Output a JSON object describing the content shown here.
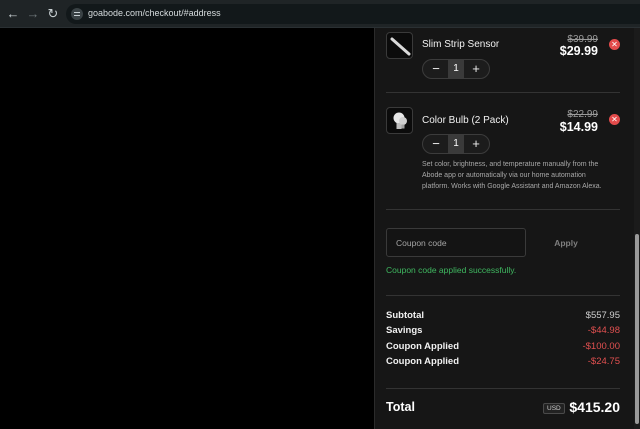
{
  "browser": {
    "url": "goabode.com/checkout/#address",
    "back_icon": "arrow-left-icon",
    "forward_icon": "arrow-right-icon",
    "reload_icon": "reload-icon"
  },
  "cart": {
    "items": [
      {
        "name": "Slim Strip Sensor",
        "old_price": "$39.99",
        "price": "$29.99",
        "quantity": "1",
        "minus": "−",
        "plus": "+"
      },
      {
        "name": "Color Bulb (2 Pack)",
        "old_price": "$22.99",
        "price": "$14.99",
        "quantity": "1",
        "minus": "−",
        "plus": "+",
        "description": "Set color, brightness, and temperature manually from the Abode app or automatically via our home automation platform. Works with Google Assistant and Amazon Alexa."
      }
    ],
    "remove_icon": "close-icon"
  },
  "coupon": {
    "placeholder": "Coupon code",
    "value": "",
    "apply_label": "Apply",
    "success_message": "Coupon code applied successfully."
  },
  "summary": {
    "rows": [
      {
        "label": "Subtotal",
        "value": "$557.95"
      },
      {
        "label": "Savings",
        "value": "-$44.98"
      },
      {
        "label": "Coupon Applied",
        "value": "-$100.00"
      },
      {
        "label": "Coupon Applied",
        "value": "-$24.75"
      }
    ],
    "total_label": "Total",
    "currency": "USD",
    "total_value": "$415.20"
  },
  "colors": {
    "success": "#3fb860",
    "negative": "#e05050",
    "remove": "#e34b4b"
  }
}
